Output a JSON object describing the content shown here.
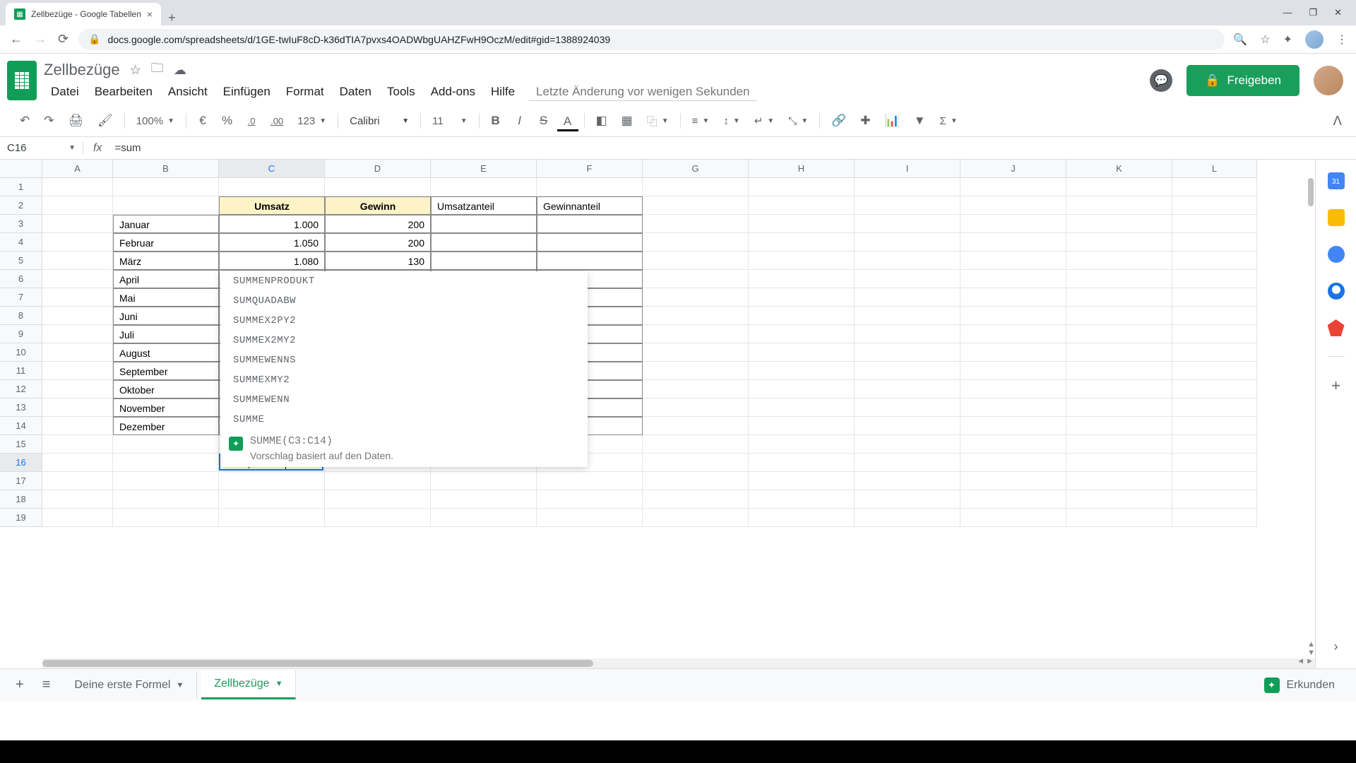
{
  "browser": {
    "tab_title": "Zellbezüge - Google Tabellen",
    "url": "docs.google.com/spreadsheets/d/1GE-twIuF8cD-k36dTIA7pvxs4OADWbgUAHZFwH9OczM/edit#gid=1388924039"
  },
  "header": {
    "doc_title": "Zellbezüge",
    "menus": [
      "Datei",
      "Bearbeiten",
      "Ansicht",
      "Einfügen",
      "Format",
      "Daten",
      "Tools",
      "Add-ons",
      "Hilfe"
    ],
    "last_edit": "Letzte Änderung vor wenigen Sekunden",
    "share_label": "Freigeben"
  },
  "toolbar": {
    "zoom": "100%",
    "currency": "€",
    "percent": "%",
    "dec_minus": ".0",
    "dec_plus": ".00",
    "format_more": "123",
    "font": "Calibri",
    "font_size": "11"
  },
  "formula_bar": {
    "name_box": "C16",
    "fx": "fx",
    "formula": "=sum"
  },
  "columns": [
    "A",
    "B",
    "C",
    "D",
    "E",
    "F",
    "G",
    "H",
    "I",
    "J",
    "K",
    "L"
  ],
  "table": {
    "headers": {
      "c": "Umsatz",
      "d": "Gewinn",
      "e": "Umsatzanteil",
      "f": "Gewinnanteil"
    },
    "rows": [
      {
        "b": "Januar",
        "c": "1.000",
        "d": "200"
      },
      {
        "b": "Februar",
        "c": "1.050",
        "d": "200"
      },
      {
        "b": "März",
        "c": "1.080",
        "d": "130"
      },
      {
        "b": "April"
      },
      {
        "b": "Mai"
      },
      {
        "b": "Juni"
      },
      {
        "b": "Juli"
      },
      {
        "b": "August"
      },
      {
        "b": "September"
      },
      {
        "b": "Oktober"
      },
      {
        "b": "November"
      },
      {
        "b": "Dezember"
      }
    ]
  },
  "editing": {
    "value": "=sum"
  },
  "autocomplete": {
    "items": [
      "SUMMENPRODUKT",
      "SUMQUADABW",
      "SUMMEX2PY2",
      "SUMMEX2MY2",
      "SUMMEWENNS",
      "SUMMEXMY2",
      "SUMMEWENN",
      "SUMME"
    ],
    "suggest_formula": "SUMME(C3:C14)",
    "suggest_desc": "Vorschlag basiert auf den Daten."
  },
  "sheets": {
    "tab1": "Deine erste Formel",
    "tab2": "Zellbezüge",
    "explore": "Erkunden"
  }
}
